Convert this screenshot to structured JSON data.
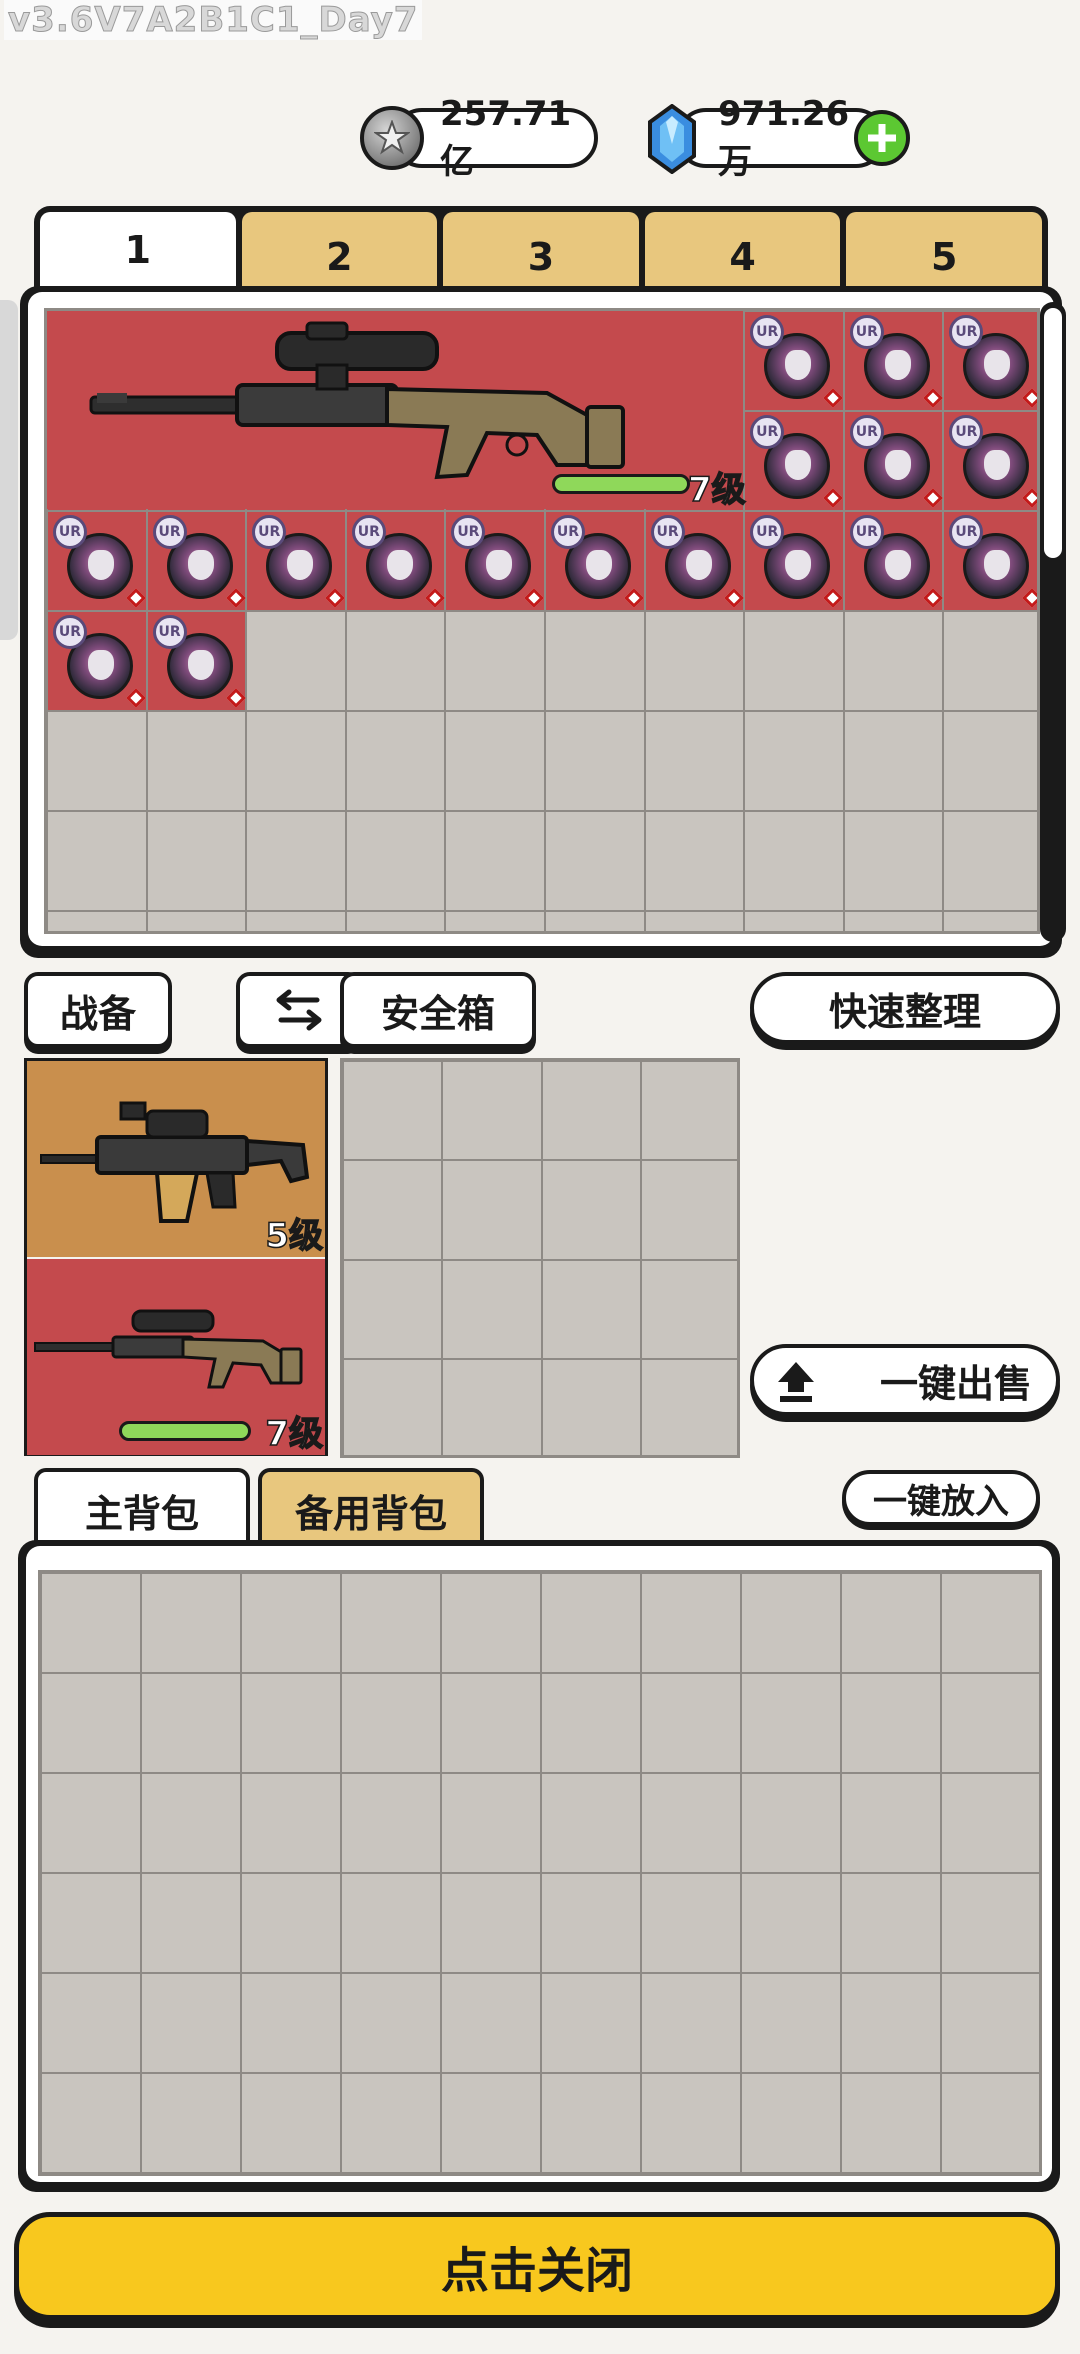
{
  "version": "v3.6V7A2B1C1_Day7",
  "currency": {
    "coins": "257.71亿",
    "gems": "971.26万"
  },
  "stash_tabs": [
    "1",
    "2",
    "3",
    "4",
    "5"
  ],
  "active_stash_tab": "1",
  "stash_items": {
    "sniper_level": "7级",
    "ur_badge": "UR"
  },
  "loadout": {
    "gear_label": "战备",
    "safe_box_label": "安全箱",
    "quick_sort_label": "快速整理",
    "sell_all_label": "一键出售",
    "put_all_label": "一键放入",
    "primary_weapon_level": "5级",
    "secondary_weapon_level": "7级"
  },
  "bag_tabs": [
    "主背包",
    "备用背包"
  ],
  "close_label": "点击关闭",
  "colors": {
    "accent_yellow": "#f8c81e",
    "tab_tan": "#e8c77e",
    "slot_red": "#c44a4d",
    "slot_tan": "#c98f4d"
  }
}
